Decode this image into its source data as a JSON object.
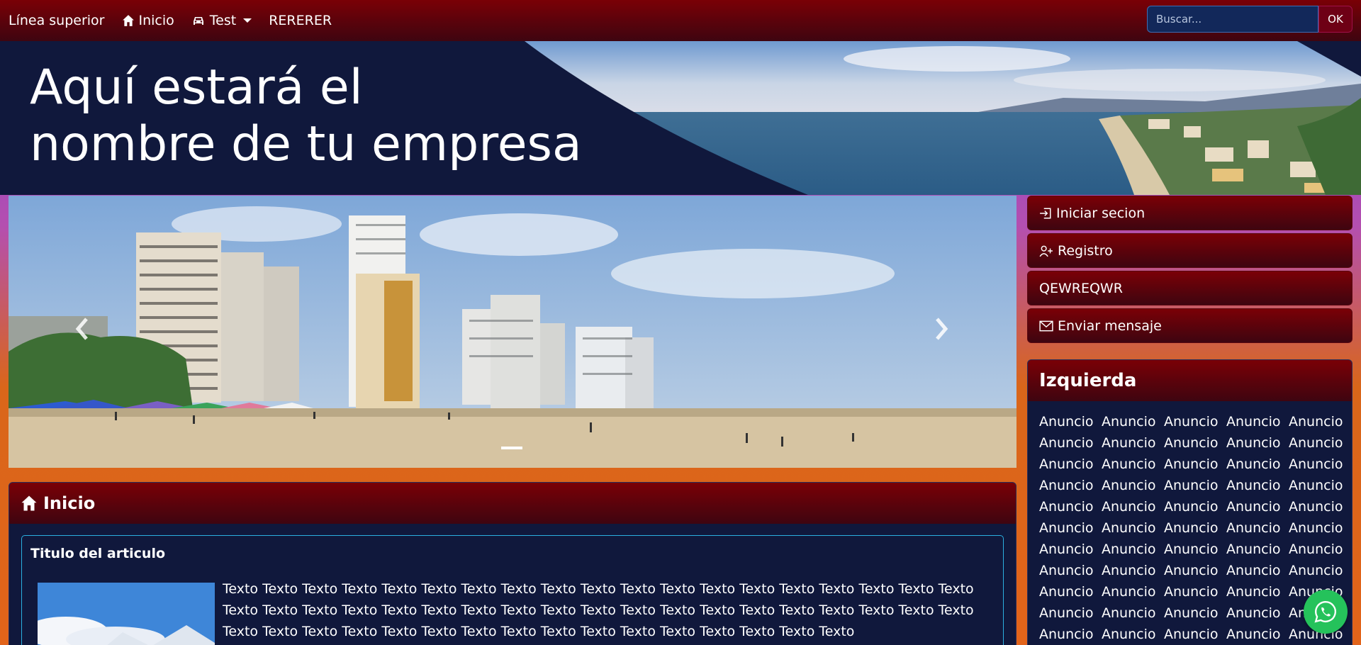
{
  "navbar": {
    "brand": "Línea superior",
    "items": [
      {
        "label": "Inicio",
        "icon": "home-icon"
      },
      {
        "label": "Test",
        "icon": "car-icon",
        "dropdown": true
      },
      {
        "label": "RERERER"
      }
    ],
    "search": {
      "placeholder": "Buscar...",
      "value": "",
      "button_label": "OK"
    }
  },
  "hero": {
    "title_line1": "Aquí estará el",
    "title_line2": "nombre de tu empresa"
  },
  "carousel": {
    "prev_icon": "chevron-left-icon",
    "next_icon": "chevron-right-icon"
  },
  "main_card": {
    "title": "Inicio",
    "icon": "home-icon",
    "article": {
      "title": "Titulo del articulo",
      "text": "Texto Texto Texto Texto Texto Texto Texto Texto Texto Texto Texto Texto Texto Texto Texto Texto Texto Texto Texto Texto Texto Texto Texto Texto Texto Texto Texto Texto Texto Texto Texto Texto Texto Texto Texto Texto Texto Texto Texto Texto Texto Texto Texto Texto Texto Texto Texto Texto Texto Texto Texto Texto Texto Texto"
    }
  },
  "sidebar": {
    "buttons": [
      {
        "label": "Iniciar secion",
        "icon": "login-icon"
      },
      {
        "label": "Registro",
        "icon": "user-plus-icon"
      },
      {
        "label": "QEWREQWR",
        "icon": ""
      },
      {
        "label": "Enviar mensaje",
        "icon": "envelope-icon"
      }
    ],
    "ads_card": {
      "title": "Izquierda",
      "ad_label": "Anuncio",
      "ad_count": 55
    }
  },
  "whatsapp": {
    "icon": "whatsapp-icon"
  },
  "colors": {
    "nav_top": "#7a0006",
    "nav_bottom": "#3e0510",
    "panel": "#10183c",
    "accent_border": "#2bb0e0",
    "whatsapp": "#25c25b"
  }
}
